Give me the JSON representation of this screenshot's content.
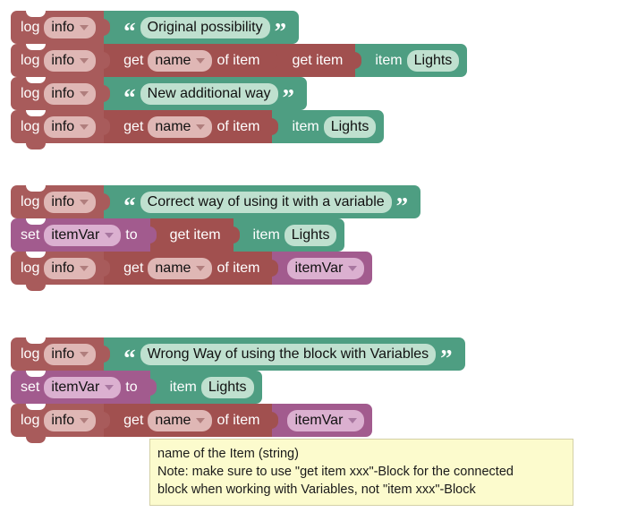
{
  "workspace": {
    "label": "blockly-workspace",
    "colors": {
      "statement_red": "#a85b5b",
      "reporter_red": "#a1504f",
      "string_green": "#4e9e82",
      "variable_purple": "#a25b8e",
      "dropdown_red_field": "#dfb7b5",
      "dropdown_purple_field": "#dbb0d0",
      "text_field_green": "#bfe0cf",
      "tooltip_background": "#fcfbcd",
      "canvas_background": "#ffffff"
    }
  },
  "stacks": [
    {
      "name": "original-and-new-possibility-stack",
      "rows": [
        {
          "name": "log-original-possibility-row",
          "segments": [
            {
              "type": "statement",
              "color": "red",
              "label": "log",
              "dropdown": "info"
            },
            {
              "type": "string",
              "color": "green",
              "open_quote": "“",
              "value": "Original possibility",
              "close_quote": "”"
            }
          ]
        },
        {
          "name": "log-get-name-of-item-get-item-row",
          "segments": [
            {
              "type": "statement",
              "color": "red",
              "label": "log",
              "dropdown": "info"
            },
            {
              "type": "reporter",
              "color": "redd",
              "label_before": "get",
              "dropdown": "name",
              "label_after": "of item"
            },
            {
              "type": "reporter",
              "color": "redd",
              "label": "get item"
            },
            {
              "type": "reporter",
              "color": "green",
              "label_before": "item",
              "value": "Lights"
            }
          ]
        },
        {
          "name": "log-new-additional-way-row",
          "segments": [
            {
              "type": "statement",
              "color": "red",
              "label": "log",
              "dropdown": "info"
            },
            {
              "type": "string",
              "color": "green",
              "open_quote": "“",
              "value": "New additional way",
              "close_quote": "”"
            }
          ]
        },
        {
          "name": "log-get-name-of-item-item-row",
          "segments": [
            {
              "type": "statement",
              "color": "red",
              "label": "log",
              "dropdown": "info"
            },
            {
              "type": "reporter",
              "color": "redd",
              "label_before": "get",
              "dropdown": "name",
              "label_after": "of item"
            },
            {
              "type": "reporter",
              "color": "green",
              "label_before": "item",
              "value": "Lights"
            }
          ]
        }
      ]
    },
    {
      "name": "correct-way-variable-stack",
      "rows": [
        {
          "name": "log-correct-way-row",
          "segments": [
            {
              "type": "statement",
              "color": "red",
              "label": "log",
              "dropdown": "info"
            },
            {
              "type": "string",
              "color": "green",
              "open_quote": "“",
              "value": "Correct way of using it with a variable",
              "close_quote": "”"
            }
          ]
        },
        {
          "name": "set-itemvar-to-get-item-row",
          "segments": [
            {
              "type": "statement",
              "color": "purple",
              "label": "set",
              "dropdown": "itemVar",
              "label_after": "to"
            },
            {
              "type": "reporter",
              "color": "redd",
              "label": "get item"
            },
            {
              "type": "reporter",
              "color": "green",
              "label_before": "item",
              "value": "Lights"
            }
          ]
        },
        {
          "name": "log-get-name-of-item-itemvar-row",
          "segments": [
            {
              "type": "statement",
              "color": "red",
              "label": "log",
              "dropdown": "info"
            },
            {
              "type": "reporter",
              "color": "redd",
              "label_before": "get",
              "dropdown": "name",
              "label_after": "of item"
            },
            {
              "type": "variable",
              "color": "purple",
              "dropdown": "itemVar"
            }
          ]
        }
      ]
    },
    {
      "name": "wrong-way-variable-stack",
      "rows": [
        {
          "name": "log-wrong-way-row",
          "segments": [
            {
              "type": "statement",
              "color": "red",
              "label": "log",
              "dropdown": "info"
            },
            {
              "type": "string",
              "color": "green",
              "open_quote": "“",
              "value": "Wrong Way of using the block with Variables",
              "close_quote": "”"
            }
          ]
        },
        {
          "name": "set-itemvar-to-item-row",
          "segments": [
            {
              "type": "statement",
              "color": "purple",
              "label": "set",
              "dropdown": "itemVar",
              "label_after": "to"
            },
            {
              "type": "reporter",
              "color": "green",
              "label_before": "item",
              "value": "Lights"
            }
          ]
        },
        {
          "name": "log-get-name-of-item-itemvar-wrong-row",
          "segments": [
            {
              "type": "statement",
              "color": "red",
              "label": "log",
              "dropdown": "info"
            },
            {
              "type": "reporter",
              "color": "redd",
              "label_before": "get",
              "dropdown": "name",
              "label_after": "of item"
            },
            {
              "type": "variable",
              "color": "purple",
              "dropdown": "itemVar"
            }
          ]
        }
      ]
    }
  ],
  "tooltip": {
    "name": "block-tooltip",
    "lines": [
      "name of the Item (string)",
      "Note: make sure to use \"get item xxx\"-Block for the connected",
      "block when working with Variables, not \"item xxx\"-Block"
    ]
  }
}
